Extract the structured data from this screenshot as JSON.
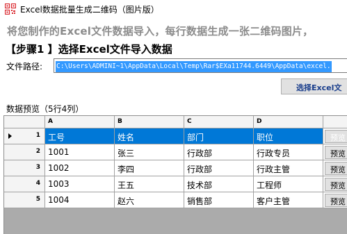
{
  "window": {
    "title": "Excel数据批量生成二维码（图片版）"
  },
  "subtitle": "将您制作的Excel文件数据导入，每行数据生成一张二维码图片，",
  "step": "【步骤1 】选择Excel文件导入数据",
  "path": {
    "label": "文件路径:",
    "value": "C:\\Users\\ADMINI~1\\AppData\\Local\\Temp\\Rar$EXa11744.6449\\AppData\\excel."
  },
  "select_button": "选择Excel文",
  "preview": {
    "label": "数据预览（5行4列）"
  },
  "grid": {
    "columns": [
      "A",
      "B",
      "C",
      "D"
    ],
    "rows": [
      {
        "num": "1",
        "cells": [
          "工号",
          "姓名",
          "部门",
          "职位"
        ],
        "action": "预览"
      },
      {
        "num": "2",
        "cells": [
          "1001",
          "张三",
          "行政部",
          "行政专员"
        ],
        "action": "预览"
      },
      {
        "num": "3",
        "cells": [
          "1002",
          "李四",
          "行政部",
          "行政主管"
        ],
        "action": "预览"
      },
      {
        "num": "4",
        "cells": [
          "1003",
          "王五",
          "技术部",
          "工程师"
        ],
        "action": "预览"
      },
      {
        "num": "5",
        "cells": [
          "1004",
          "赵六",
          "销售部",
          "客户主管"
        ],
        "action": "预览"
      }
    ],
    "selected_row": 0
  },
  "colors": {
    "selection": "#0078d7",
    "path_highlight": "#3399ff",
    "button_text": "#1a3e8c",
    "icon": "#d9262c"
  },
  "icons": {
    "app": "qr-code-icon",
    "row_pointer": "row-pointer-icon"
  }
}
